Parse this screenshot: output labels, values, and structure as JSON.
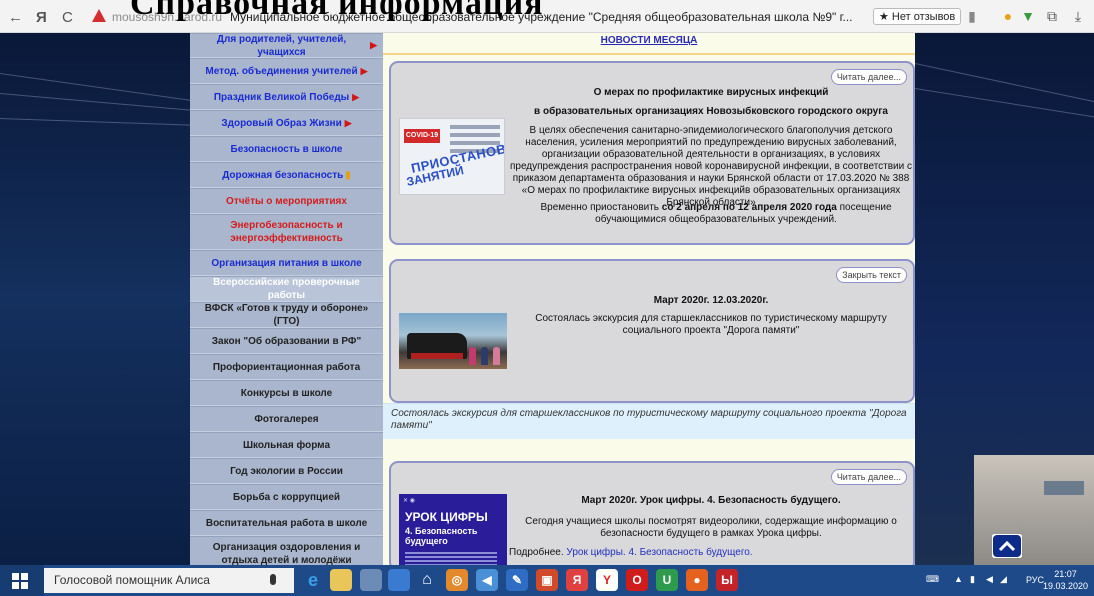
{
  "browser": {
    "back": "←",
    "yandex": "Я",
    "reload": "C",
    "url": "mousosh9n.narod.ru",
    "tab_title": "Муниципальное бюджетное общеобразовательное учреждение \"Средняя общеобразовательная школа №9\" г...",
    "reviews": "★ Нет отзывов"
  },
  "overlay_text": "Справочная информация",
  "sidebar": {
    "items": [
      {
        "label": "Для родителей, учителей, учащихся",
        "arrow": "▶"
      },
      {
        "label": "Метод. объединения учителей",
        "arrow": "▶"
      },
      {
        "label": "Праздник Великой Победы",
        "arrow": "▶"
      },
      {
        "label": "Здоровый Образ Жизни",
        "arrow": "▶"
      },
      {
        "label": "Безопасность в школе"
      },
      {
        "label": "Дорожная безопасность"
      },
      {
        "label": "Отчёты о мероприятиях"
      },
      {
        "label": "Энергобезопасность и энергоэффективность"
      },
      {
        "label": "Организация питания в школе"
      },
      {
        "label": "Всероссийские проверочные работы"
      },
      {
        "label": "ВФСК «Готов к труду и обороне» (ГТО)"
      },
      {
        "label": "Закон \"Об образовании в РФ\""
      },
      {
        "label": "Профориентационная работа"
      },
      {
        "label": "Конкурсы в школе"
      },
      {
        "label": "Фотогалерея"
      },
      {
        "label": "Школьная форма"
      },
      {
        "label": "Год экологии в России"
      },
      {
        "label": "Борьба с коррупцией"
      },
      {
        "label": "Воспитательная работа в школе"
      },
      {
        "label": "Организация оздоровления и отдыха детей и молодёжи"
      }
    ]
  },
  "content": {
    "header": "НОВОСТИ МЕСЯЦА",
    "card1": {
      "button": "Читать далее...",
      "title1": "О мерах по профилактике вирусных инфекций",
      "title2": "в образовательных организациях Новозыбковского городского округа",
      "text": "В целях обеспечения санитарно-эпидемиологического благополучия детского населения, усиления мероприятий по предупреждению вирусных заболеваний, организации образовательной деятельности в организациях, в условиях предупреждения распространения новой коронавирусной инфекции, в соответствии с приказом департамента образования и науки Брянской области от 17.03.2020 № 388 «О мерах по профилактике вирусных инфекцийв образовательных организациях Брянской области»",
      "text2_pre": "Временно приостановить ",
      "text2_bold": "со 2 апреля по 12 апреля 2020 года",
      "text2_post": " посещение обучающимися общеобразовательных учреждений.",
      "img_covid": "COVID-19",
      "img_stamp1": "ПРИОСТАНОВКА",
      "img_stamp2": "ЗАНЯТИЙ"
    },
    "card2": {
      "button": "Закрыть текст",
      "title": "Март 2020г. 12.03.2020г.",
      "text": "Состоялась экскурсия для старшеклассников по туристическому маршруту социального проекта \"Дорога памяти\"",
      "footer": "Состоялась экскурсия для старшеклассников по туристическому маршруту социального проекта \"Дорога памяти\""
    },
    "card3": {
      "button": "Читать далее...",
      "title": "Март 2020г. Урок цифры. 4. Безопасность будущего.",
      "text": "Сегодня учащиеся школы посмотрят видеоролики, содержащие информацию о безопасности будущего в рамках Урока цифры.",
      "more_label": "Подробнее. ",
      "more_link": "Урок цифры. 4. Безопасность будущего.",
      "img_big": "УРОК ЦИФРЫ",
      "img_sub": "4. Безопасность будущего"
    }
  },
  "taskbar": {
    "search": "Голосовой помощник Алиса",
    "lang": "РУС",
    "time": "21:07",
    "date": "19.03.2020"
  },
  "colors": {
    "menu_blue": "#1a2bd0",
    "menu_red": "#d41c1c",
    "card_border": "#8d92c8",
    "content_bg": "#fbfbe9"
  }
}
